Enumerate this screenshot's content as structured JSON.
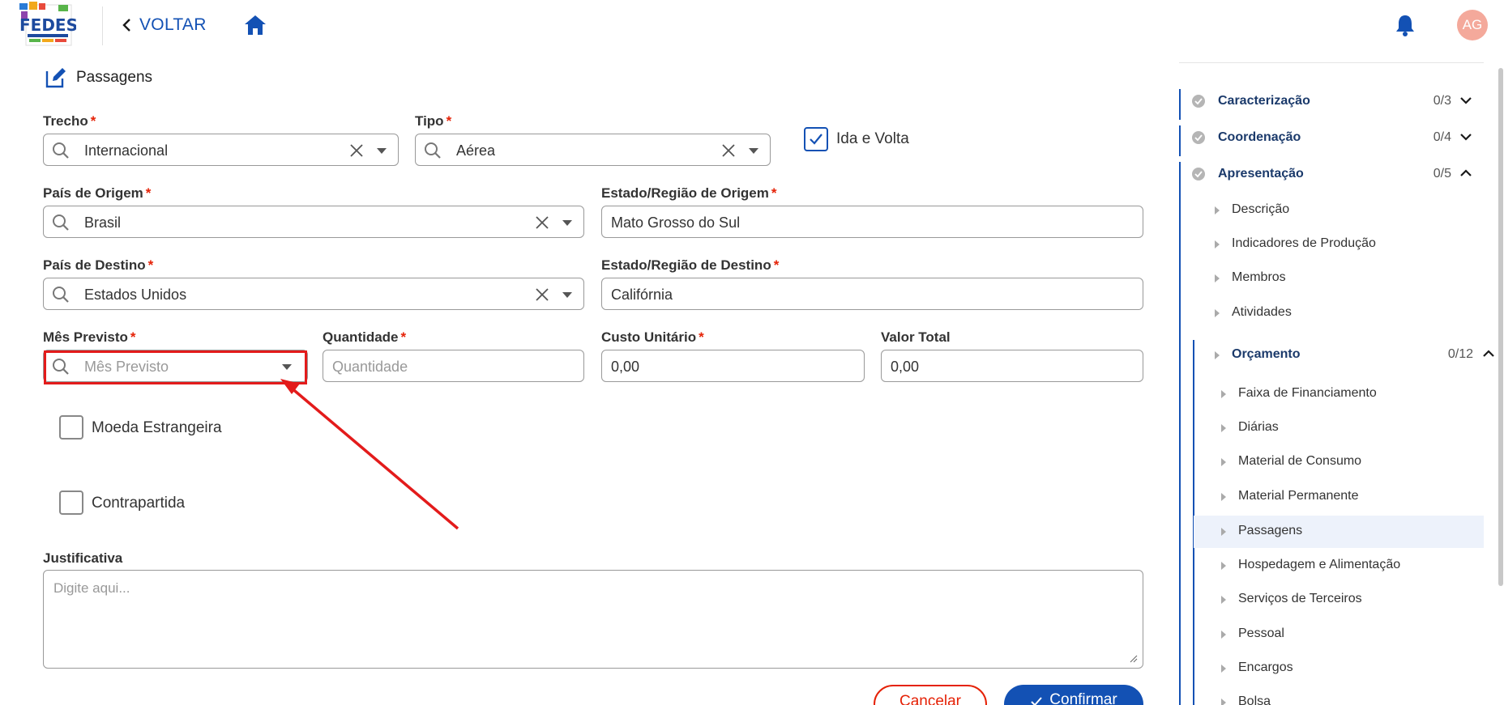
{
  "header": {
    "back_label": "VOLTAR",
    "avatar_initials": "AG",
    "logo_text": "FEDES"
  },
  "page": {
    "title": "Passagens"
  },
  "form": {
    "trecho": {
      "label": "Trecho",
      "value": "Internacional"
    },
    "tipo": {
      "label": "Tipo",
      "value": "Aérea"
    },
    "ida_volta": {
      "label": "Ida e Volta",
      "checked": true
    },
    "pais_origem": {
      "label": "País de Origem",
      "value": "Brasil"
    },
    "estado_origem": {
      "label": "Estado/Região de Origem",
      "value": "Mato Grosso do Sul"
    },
    "pais_destino": {
      "label": "País de Destino",
      "value": "Estados Unidos"
    },
    "estado_destino": {
      "label": "Estado/Região de Destino",
      "value": "Califórnia"
    },
    "mes_previsto": {
      "label": "Mês Previsto",
      "placeholder": "Mês Previsto"
    },
    "quantidade": {
      "label": "Quantidade",
      "placeholder": "Quantidade"
    },
    "custo_unitario": {
      "label": "Custo Unitário",
      "value": "0,00"
    },
    "valor_total": {
      "label": "Valor Total",
      "value": "0,00"
    },
    "moeda_estrangeira": {
      "label": "Moeda Estrangeira",
      "checked": false
    },
    "contrapartida": {
      "label": "Contrapartida",
      "checked": false
    },
    "justificativa": {
      "label": "Justificativa",
      "placeholder": "Digite aqui..."
    },
    "cancel_label": "Cancelar",
    "confirm_label": "Confirmar",
    "required_mark": "*"
  },
  "sidebar": {
    "sections": [
      {
        "name": "Caracterização",
        "count": "0/3",
        "expanded": false
      },
      {
        "name": "Coordenação",
        "count": "0/4",
        "expanded": false
      },
      {
        "name": "Apresentação",
        "count": "0/5",
        "expanded": true
      }
    ],
    "apresentacao_items": [
      "Descrição",
      "Indicadores de Produção",
      "Membros",
      "Atividades"
    ],
    "orcamento": {
      "name": "Orçamento",
      "count": "0/12"
    },
    "orcamento_items": [
      "Faixa de Financiamento",
      "Diárias",
      "Material de Consumo",
      "Material Permanente",
      "Passagens",
      "Hospedagem e Alimentação",
      "Serviços de Terceiros",
      "Pessoal",
      "Encargos",
      "Bolsa"
    ],
    "active_item": "Passagens"
  },
  "colors": {
    "primary": "#1351b4",
    "required": "#e52207",
    "highlight": "#e31b1b",
    "avatar": "#f4a99b",
    "active_bg": "#edf2fb"
  }
}
